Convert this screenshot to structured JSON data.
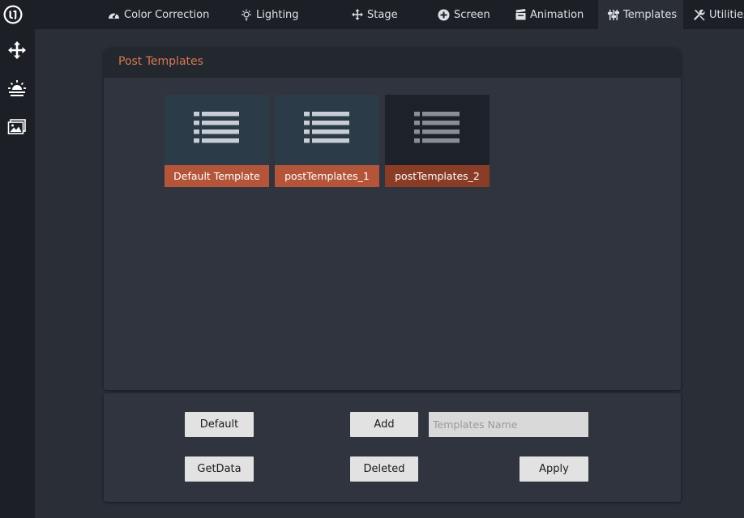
{
  "nav": {
    "tabs": [
      {
        "label": "Color Correction",
        "icon": "gauge-icon"
      },
      {
        "label": "Lighting",
        "icon": "bulb-icon"
      },
      {
        "label": "Stage",
        "icon": "move-icon"
      },
      {
        "label": "Screen",
        "icon": "plus-circle-icon"
      },
      {
        "label": "Animation",
        "icon": "clapperboard-icon"
      },
      {
        "label": "Templates",
        "icon": "sliders-icon"
      },
      {
        "label": "Utilities",
        "icon": "tools-icon"
      }
    ],
    "active_tab": "Templates"
  },
  "sidebar": {
    "items": [
      "move-icon",
      "sunset-icon",
      "images-icon"
    ]
  },
  "panel": {
    "title": "Post Templates",
    "templates": [
      {
        "label": "Default Template",
        "selected": false
      },
      {
        "label": "postTemplates_1",
        "selected": false
      },
      {
        "label": "postTemplates_2",
        "selected": true
      }
    ]
  },
  "actions": {
    "default_label": "Default",
    "add_label": "Add",
    "name_placeholder": "Templates Name",
    "name_value": "",
    "getdata_label": "GetData",
    "deleted_label": "Deleted",
    "apply_label": "Apply"
  },
  "colors": {
    "accent": "#d97854",
    "card_label": "#b4553a",
    "background": "#2a2e37",
    "topbar": "#1c1f26"
  }
}
